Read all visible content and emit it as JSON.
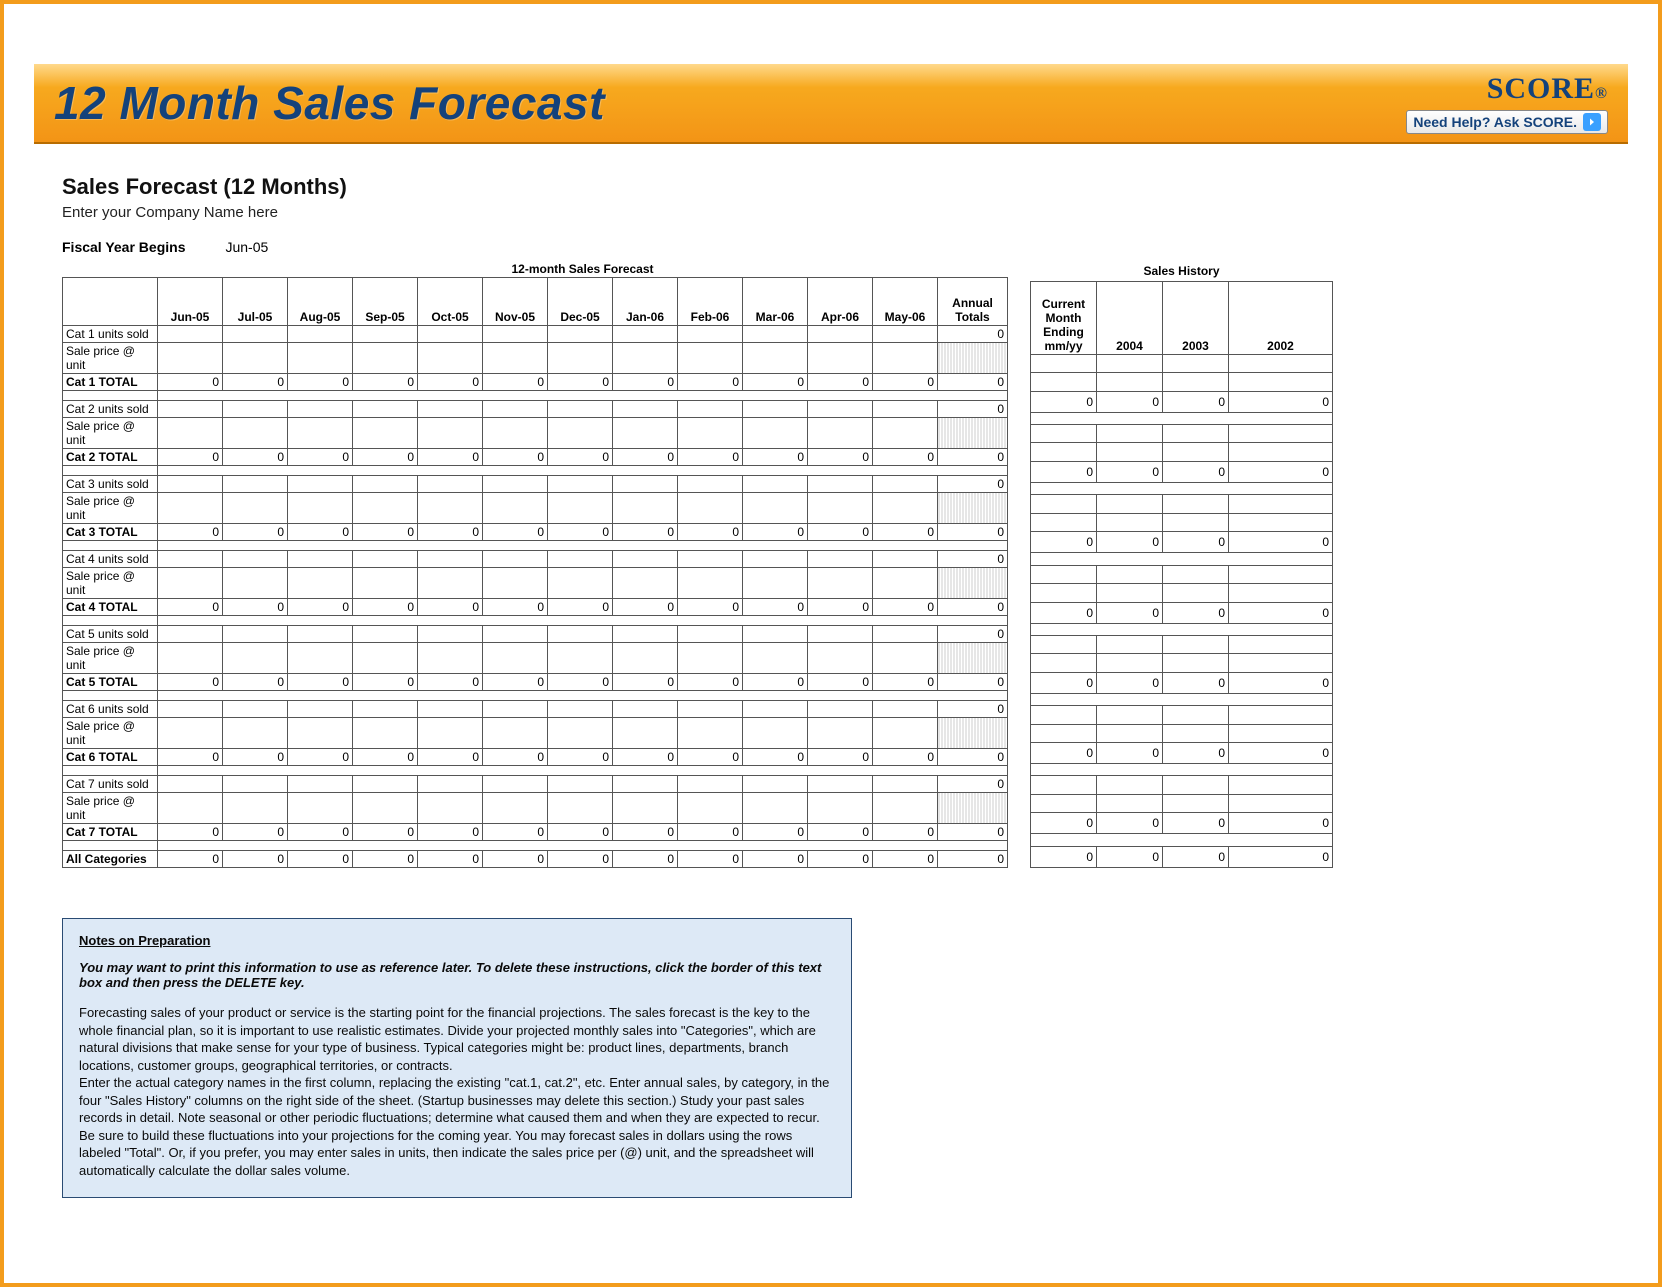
{
  "banner": {
    "title": "12 Month Sales Forecast",
    "brand": "SCORE",
    "brand_mark": "®",
    "help_label": "Need Help? Ask SCORE."
  },
  "sheet": {
    "section_title": "Sales Forecast (12 Months)",
    "company_line": "Enter your Company Name here",
    "fiscal_label": "Fiscal Year Begins",
    "fiscal_value": "Jun-05",
    "main_supertitle": "12-month Sales Forecast",
    "hist_supertitle": "Sales History",
    "months": [
      "Jun-05",
      "Jul-05",
      "Aug-05",
      "Sep-05",
      "Oct-05",
      "Nov-05",
      "Dec-05",
      "Jan-06",
      "Feb-06",
      "Mar-06",
      "Apr-06",
      "May-06"
    ],
    "annual_totals_label": "Annual Totals",
    "hist_head_current": "Current Month Ending mm/yy",
    "hist_years": [
      "2004",
      "2003",
      "2002"
    ],
    "row_groups": [
      {
        "units": "Cat 1 units sold",
        "price": "Sale price @ unit",
        "total": "Cat 1 TOTAL"
      },
      {
        "units": "Cat 2 units sold",
        "price": "Sale price @ unit",
        "total": "Cat 2 TOTAL"
      },
      {
        "units": "Cat 3 units sold",
        "price": "Sale price @ unit",
        "total": "Cat 3 TOTAL"
      },
      {
        "units": "Cat 4 units sold",
        "price": "Sale price @ unit",
        "total": "Cat 4 TOTAL"
      },
      {
        "units": "Cat 5 units sold",
        "price": "Sale price @ unit",
        "total": "Cat 5 TOTAL"
      },
      {
        "units": "Cat 6 units sold",
        "price": "Sale price @ unit",
        "total": "Cat 6 TOTAL"
      },
      {
        "units": "Cat 7 units sold",
        "price": "Sale price @ unit",
        "total": "Cat 7 TOTAL"
      }
    ],
    "all_label": "All Categories",
    "zero": "0"
  },
  "notes": {
    "title": "Notes on Preparation",
    "lead": "You may want to print this information to use as reference later. To delete these instructions, click the border of this text box and then press the DELETE key.",
    "p1": "Forecasting sales of your product or service is the starting point for the financial projections. The sales forecast is the key to the whole financial plan, so it is important to use realistic estimates. Divide your projected monthly sales into \"Categories\", which are natural divisions that make sense for your type of business. Typical categories might be: product lines, departments, branch locations, customer groups, geographical territories, or contracts.",
    "p2": "Enter the actual category names in the first column, replacing the existing \"cat.1, cat.2\", etc. Enter annual sales, by category, in the four \"Sales History\" columns on the right side of the sheet. (Startup businesses may delete this section.) Study your past sales records in detail. Note seasonal or other periodic fluctuations; determine what caused them and when they are expected to recur. Be sure to build these fluctuations into your projections for the coming year. You may forecast sales in dollars using the rows labeled \"Total\". Or, if you prefer, you may enter sales in units, then indicate the sales price per (@) unit, and the spreadsheet will automatically calculate the dollar sales volume."
  }
}
